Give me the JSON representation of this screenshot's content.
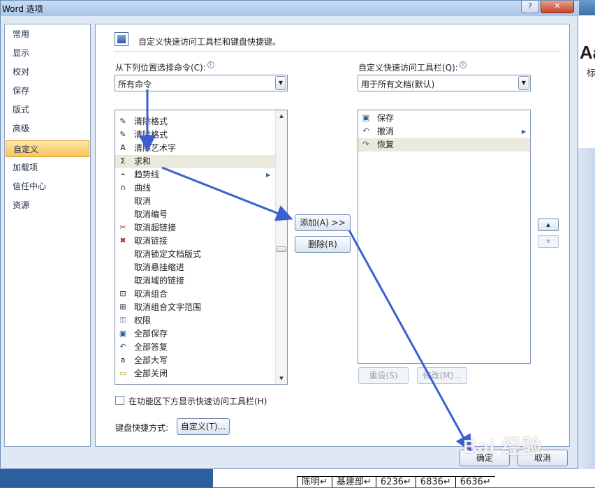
{
  "window": {
    "title": "Word 选项",
    "help_glyph": "?",
    "close_glyph": "✕"
  },
  "background": {
    "right_big_text": "Aa",
    "right_small_text": "标",
    "table_cells": [
      "陈明↵",
      "基建部↵",
      "6236↵",
      "6836↵",
      "6636↵"
    ]
  },
  "nav": {
    "items": [
      {
        "label": "常用"
      },
      {
        "label": "显示"
      },
      {
        "label": "校对"
      },
      {
        "label": "保存"
      },
      {
        "label": "版式"
      },
      {
        "label": "高级"
      },
      {
        "label": "自定义",
        "selected": true
      },
      {
        "label": "加载项"
      },
      {
        "label": "信任中心"
      },
      {
        "label": "资源"
      }
    ]
  },
  "header": {
    "title": "自定义快速访问工具栏和键盘快捷键。"
  },
  "commands": {
    "label": "从下列位置选择命令(C):",
    "source_value": "所有命令",
    "items": [
      {
        "label": "清除格式",
        "icon": "clear-format-icon"
      },
      {
        "label": "清除格式",
        "icon": "clear-format-icon"
      },
      {
        "label": "清除艺术字",
        "icon": "clear-wordart-icon"
      },
      {
        "label": "求和",
        "icon": "sigma-icon",
        "selected": true
      },
      {
        "label": "趋势线",
        "icon": "trendline-icon",
        "submenu": true
      },
      {
        "label": "曲线",
        "icon": "curve-icon"
      },
      {
        "label": "取消",
        "icon": ""
      },
      {
        "label": "取消编号",
        "icon": ""
      },
      {
        "label": "取消超链接",
        "icon": "unlink-icon"
      },
      {
        "label": "取消链接",
        "icon": "break-link-icon"
      },
      {
        "label": "取消锁定文档版式",
        "icon": ""
      },
      {
        "label": "取消悬挂缩进",
        "icon": ""
      },
      {
        "label": "取消域的链接",
        "icon": ""
      },
      {
        "label": "取消组合",
        "icon": "ungroup-icon"
      },
      {
        "label": "取消组合文字范围",
        "icon": "ungroup-text-icon"
      },
      {
        "label": "权限",
        "icon": "permission-icon"
      },
      {
        "label": "全部保存",
        "icon": "save-all-icon"
      },
      {
        "label": "全部答复",
        "icon": "reply-all-icon"
      },
      {
        "label": "全部大写",
        "icon": "all-caps-icon"
      },
      {
        "label": "全部关闭",
        "icon": "close-all-icon"
      }
    ]
  },
  "qat": {
    "label": "自定义快速访问工具栏(Q):",
    "scope_value": "用于所有文档(默认)",
    "items": [
      {
        "label": "保存",
        "icon": "save-icon"
      },
      {
        "label": "撤消",
        "icon": "undo-icon",
        "submenu": true
      },
      {
        "label": "恢复",
        "icon": "redo-icon",
        "selected": true
      }
    ]
  },
  "buttons": {
    "add": "添加(A) >>",
    "remove": "删除(R)",
    "reset": "重设(S)",
    "modify": "修改(M)...",
    "move_up": "▲",
    "move_down": "▼",
    "customize": "自定义(T)...",
    "ok": "确定",
    "cancel": "取消"
  },
  "options": {
    "show_below_ribbon_label": "在功能区下方显示快速访问工具栏(H)",
    "show_below_ribbon_checked": false,
    "keyboard_label": "键盘快捷方式:"
  },
  "watermark": "Bai 经验",
  "colors": {
    "annotation_arrow": "#3b5fd0",
    "selection": "#ebe8dc",
    "nav_selected": "#f7c45c"
  }
}
